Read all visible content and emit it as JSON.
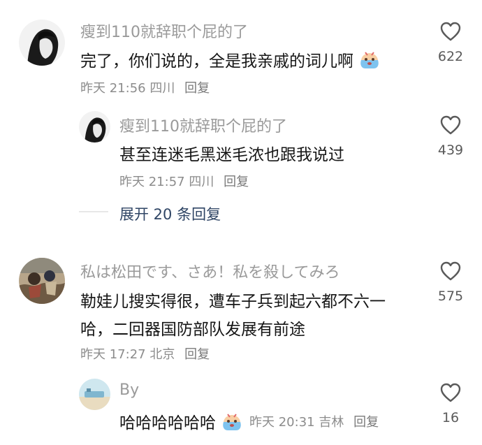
{
  "comments": [
    {
      "username": "瘦到110就辞职个屁的了",
      "text": "完了，你们说的，全是我亲戚的词儿啊",
      "time": "昨天 21:56",
      "location": "四川",
      "reply_label": "回复",
      "likes": "622",
      "emoji": "crying-face-emoji",
      "replies": [
        {
          "username": "瘦到110就辞职个屁的了",
          "text": "甚至连迷毛黑迷毛浓也跟我说过",
          "time": "昨天 21:57",
          "location": "四川",
          "reply_label": "回复",
          "likes": "439"
        }
      ],
      "expand_label": "展开 20 条回复"
    },
    {
      "username": "私は松田です、さあ！私を殺してみろ",
      "text_lines": [
        "勒娃儿搜实得很，遭车子兵到起六都不六一",
        "哈，二回器国防部队发展有前途"
      ],
      "time": "昨天 17:27",
      "location": "北京",
      "reply_label": "回复",
      "likes": "575",
      "replies": [
        {
          "username": "By",
          "text": "哈哈哈哈哈哈",
          "time": "昨天 20:31",
          "location": "吉林",
          "reply_label": "回复",
          "likes": "16",
          "emoji": "crying-face-emoji"
        }
      ]
    }
  ],
  "icons": {
    "like": "heart-outline-icon"
  },
  "colors": {
    "username": "#9a9a9a",
    "text": "#161616",
    "expand": "#2f4565"
  }
}
